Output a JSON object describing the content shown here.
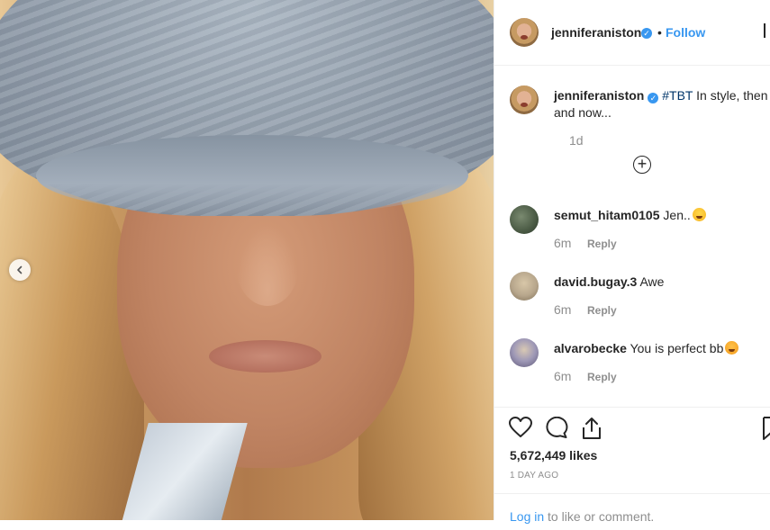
{
  "post": {
    "username": "jenniferaniston",
    "follow_label": "Follow",
    "dot": "•",
    "verified_mark": "✓",
    "caption": {
      "hashtag": "#TBT",
      "text": "In style, then and now...",
      "time": "1d"
    },
    "load_more_symbol": "+",
    "carousel_prev_symbol": "‹",
    "likes": "5,672,449 likes",
    "posted": "1 DAY AGO",
    "login": {
      "link": "Log in",
      "text": "to like or comment."
    }
  },
  "comments": [
    {
      "username": "semut_hitam0105",
      "text": "Jen..",
      "emoji": "grinning-emoji",
      "time": "6m",
      "reply": "Reply",
      "avatar_color": "#4a5a44"
    },
    {
      "username": "david.bugay.3",
      "text": "Awe",
      "emoji": "",
      "time": "6m",
      "reply": "Reply",
      "avatar_color": "#b7a68c"
    },
    {
      "username": "alvarobecke",
      "text": "You is perfect bb",
      "emoji": "heart-eyes-emoji",
      "time": "6m",
      "reply": "Reply",
      "avatar_color": "#7f7a9c"
    }
  ],
  "icons": {
    "like": "heart-icon",
    "comment": "comment-icon",
    "share": "share-icon",
    "save": "bookmark-icon",
    "more": "more-icon"
  },
  "colors": {
    "link_blue": "#3897f0",
    "hashtag": "#003569",
    "muted": "#8e8e8e",
    "text": "#262626"
  }
}
